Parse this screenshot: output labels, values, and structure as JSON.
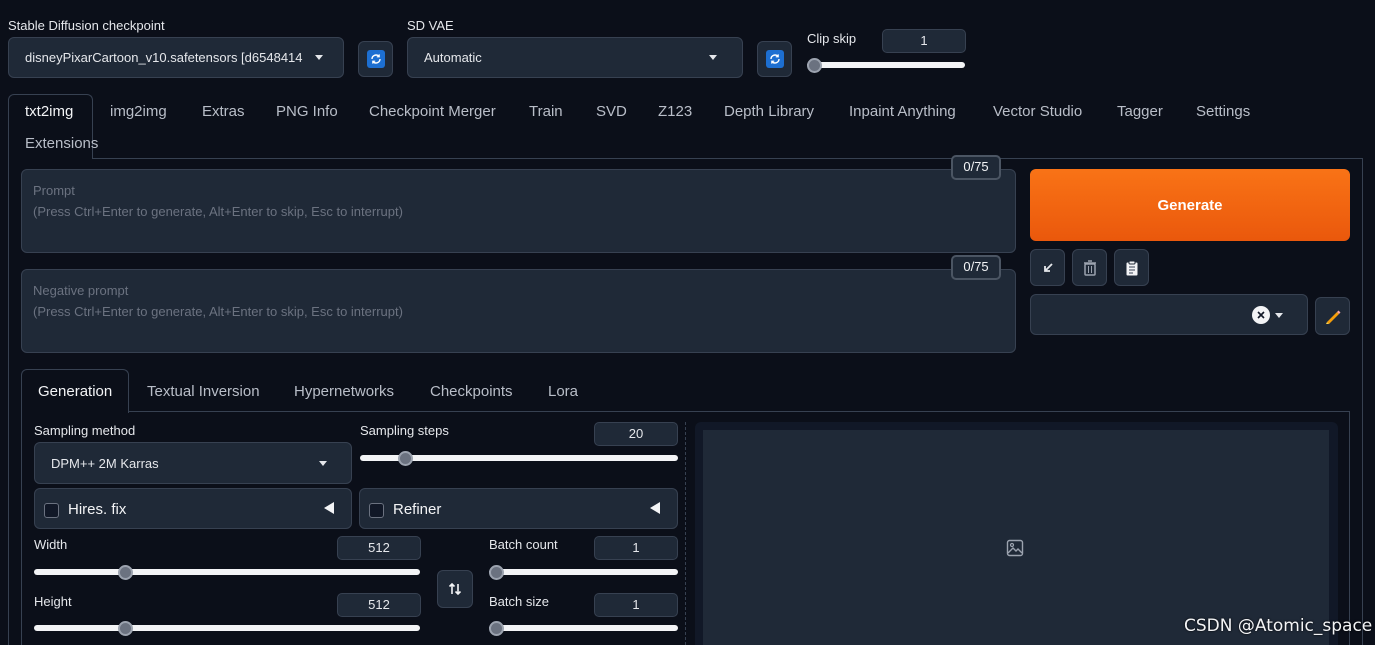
{
  "checkpoint": {
    "label": "Stable Diffusion checkpoint",
    "value": "disneyPixarCartoon_v10.safetensors [d6548414"
  },
  "vae": {
    "label": "SD VAE",
    "value": "Automatic"
  },
  "clip_skip": {
    "label": "Clip skip",
    "value": "1",
    "slider_fraction": 0.0
  },
  "main_tabs": [
    "txt2img",
    "img2img",
    "Extras",
    "PNG Info",
    "Checkpoint Merger",
    "Train",
    "SVD",
    "Z123",
    "Depth Library",
    "Inpaint Anything",
    "Vector Studio",
    "Tagger",
    "Settings",
    "Extensions"
  ],
  "prompt": {
    "label": "Prompt",
    "hint": "(Press Ctrl+Enter to generate, Alt+Enter to skip, Esc to interrupt)",
    "counter": "0/75"
  },
  "negative_prompt": {
    "label": "Negative prompt",
    "hint": "(Press Ctrl+Enter to generate, Alt+Enter to skip, Esc to interrupt)",
    "counter": "0/75"
  },
  "generate_label": "Generate",
  "sub_tabs": [
    "Generation",
    "Textual Inversion",
    "Hypernetworks",
    "Checkpoints",
    "Lora"
  ],
  "sampling_method": {
    "label": "Sampling method",
    "value": "DPM++ 2M Karras"
  },
  "sampling_steps": {
    "label": "Sampling steps",
    "value": "20",
    "slider_fraction": 0.13
  },
  "hires_fix": {
    "label": "Hires. fix"
  },
  "refiner": {
    "label": "Refiner"
  },
  "width": {
    "label": "Width",
    "value": "512",
    "slider_fraction": 0.23
  },
  "height": {
    "label": "Height",
    "value": "512",
    "slider_fraction": 0.23
  },
  "batch_count": {
    "label": "Batch count",
    "value": "1",
    "slider_fraction": 0.0
  },
  "batch_size": {
    "label": "Batch size",
    "value": "1",
    "slider_fraction": 0.0
  },
  "watermark": "CSDN @Atomic_space",
  "colors": {
    "background": "#0b0f19",
    "panel": "#1f2937",
    "border": "#374151",
    "generate_start": "#f97316",
    "generate_end": "#ea580c",
    "refresh_blue": "#1d6fd1"
  }
}
